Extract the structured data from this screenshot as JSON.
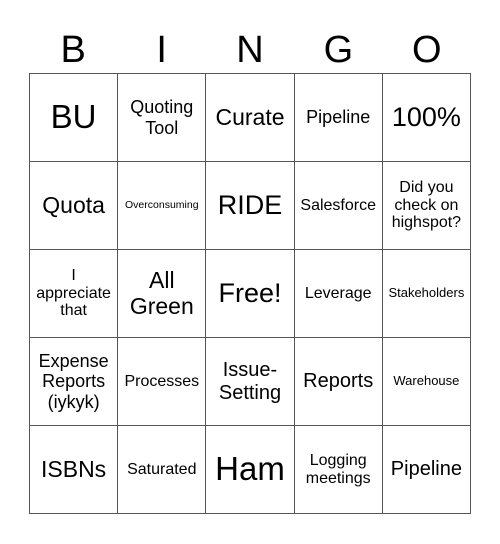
{
  "header": {
    "letters": [
      "B",
      "I",
      "N",
      "G",
      "O"
    ]
  },
  "cells": [
    "BU",
    "Quoting Tool",
    "Curate",
    "Pipeline",
    "100%",
    "Quota",
    "Overconsuming",
    "RIDE",
    "Salesforce",
    "Did you check on highspot?",
    "I appreciate that",
    "All Green",
    "Free!",
    "Leverage",
    "Stakeholders",
    "Expense Reports (iykyk)",
    "Processes",
    "Issue-Setting",
    "Reports",
    "Warehouse",
    "ISBNs",
    "Saturated",
    "Ham",
    "Logging meetings",
    "Pipeline"
  ]
}
